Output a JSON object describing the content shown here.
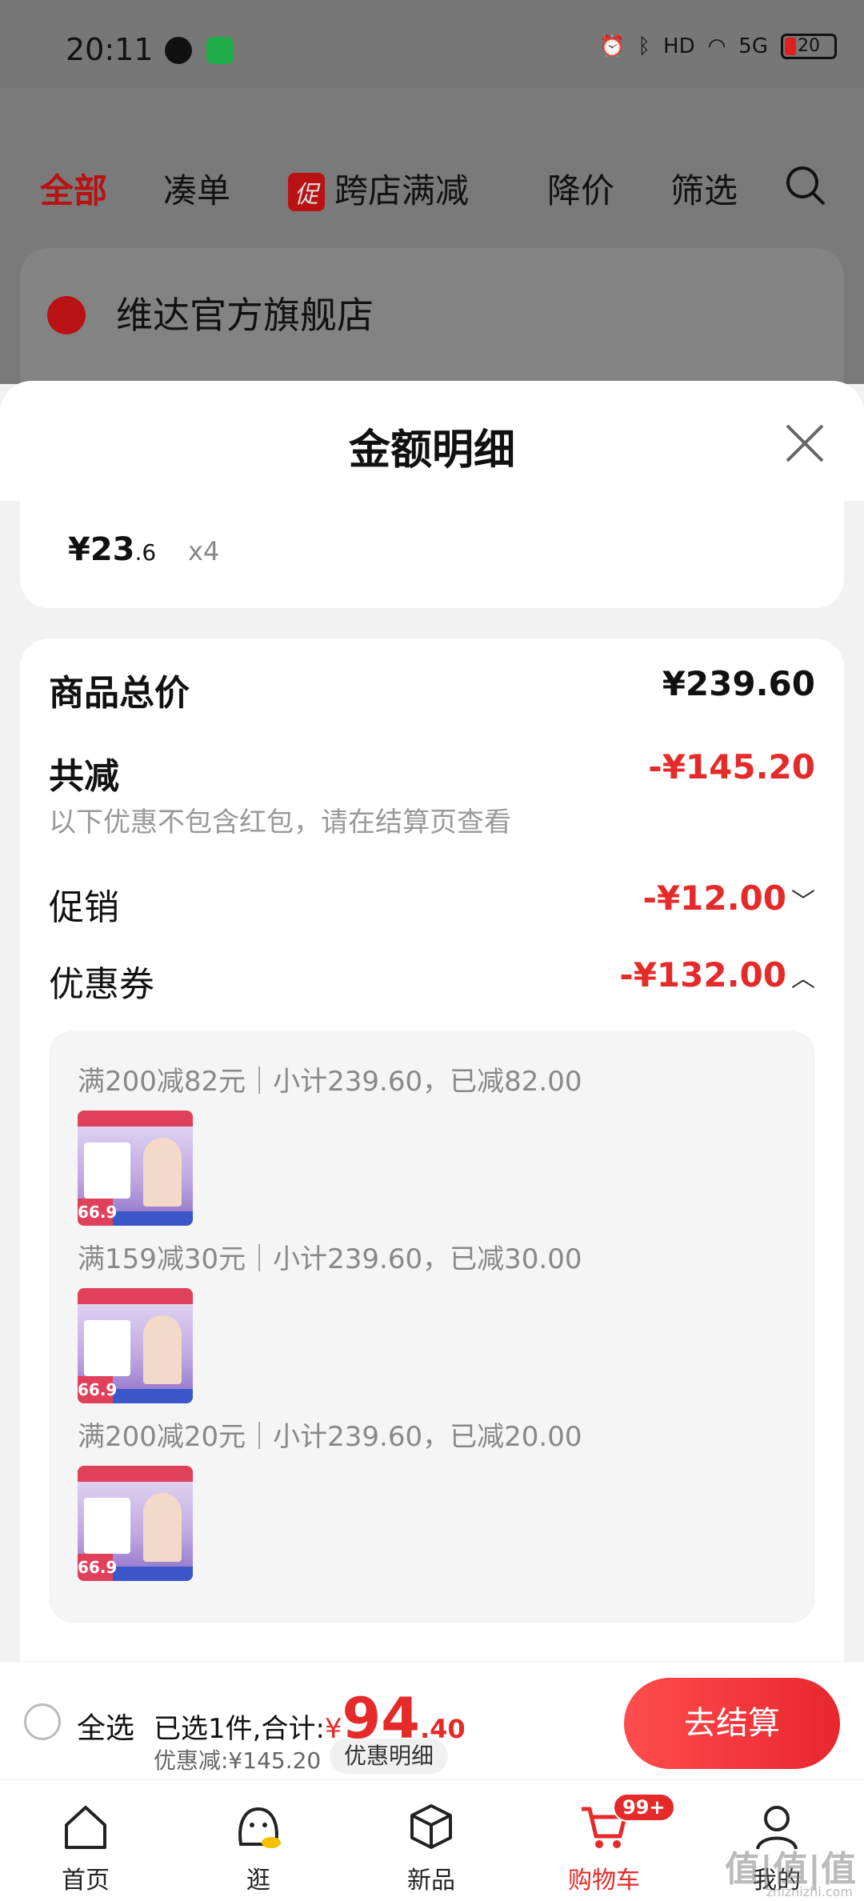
{
  "status_bar": {
    "time": "20:11",
    "battery": "20",
    "network": "5G"
  },
  "filter_tabs": {
    "all": "全部",
    "bundle": "凑单",
    "promo_badge": "促",
    "cross_store": "跨店满减",
    "price_drop": "降价",
    "filter": "筛选"
  },
  "store": {
    "name": "维达官方旗舰店"
  },
  "sheet": {
    "title": "金额明细",
    "unit_price_int": "¥23",
    "unit_price_dec": ".6",
    "quantity": "x4",
    "total_label": "商品总价",
    "total_value": "¥239.60",
    "reduce_label": "共减",
    "reduce_value": "-¥145.20",
    "reduce_note": "以下优惠不包含红包，请在结算页查看",
    "promo_label": "促销",
    "promo_value": "-¥12.00",
    "coupon_label": "优惠券",
    "coupon_value": "-¥132.00",
    "coupons": [
      {
        "text": "满200减82元｜小计239.60，已减82.00",
        "thumb_price": "66.9"
      },
      {
        "text": "满159减30元｜小计239.60，已减30.00",
        "thumb_price": "66.9"
      },
      {
        "text": "满200减20元｜小计239.60，已减20.00",
        "thumb_price": "66.9"
      }
    ]
  },
  "checkout": {
    "select_all": "全选",
    "summary_prefix": "已选1件,合计:",
    "yen": "¥",
    "total_int": "94",
    "total_dec": ".40",
    "discount": "优惠减:¥145.20",
    "detail_chip": "优惠明细",
    "checkout_button": "去结算"
  },
  "nav": {
    "home": "首页",
    "browse": "逛",
    "new": "新品",
    "cart": "购物车",
    "cart_badge": "99+",
    "me": "我的"
  },
  "watermark": {
    "text": "值|值|值",
    "sub": "zhizhizhi.com"
  },
  "colors": {
    "accent_red": "#e52a2a",
    "brand_red": "#b81212"
  }
}
